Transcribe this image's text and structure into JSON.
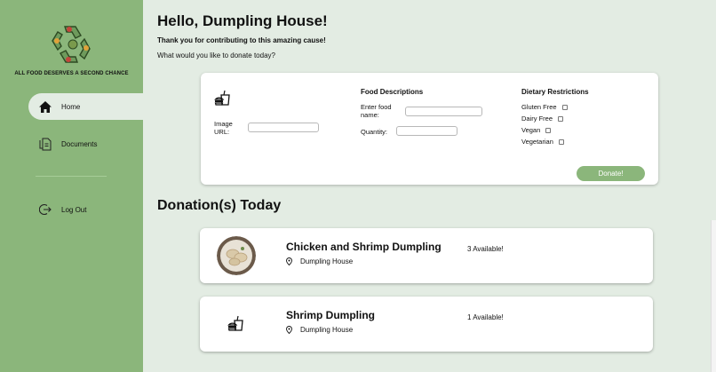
{
  "sidebar": {
    "tagline": "ALL FOOD DESERVES A SECOND CHANCE",
    "logo_icon": "recycle-food-logo",
    "items": [
      {
        "label": "Home",
        "icon": "home-icon",
        "active": true
      },
      {
        "label": "Documents",
        "icon": "documents-icon",
        "active": false
      },
      {
        "label": "Log Out",
        "icon": "logout-icon",
        "active": false
      }
    ]
  },
  "header": {
    "greeting": "Hello, Dumpling House!",
    "thanks": "Thank you for contributing to this amazing cause!",
    "question": "What would you like to donate today?"
  },
  "form": {
    "image_url_label": "Image URL:",
    "image_url_value": "",
    "descriptions_heading": "Food Descriptions",
    "food_name_label": "Enter food name:",
    "food_name_value": "",
    "quantity_label": "Quantity:",
    "quantity_value": "",
    "dietary_heading": "Dietary Restrictions",
    "dietary_options": [
      {
        "label": "Gluten Free",
        "checked": false
      },
      {
        "label": "Dairy Free",
        "checked": false
      },
      {
        "label": "Vegan",
        "checked": false
      },
      {
        "label": "Vegetarian",
        "checked": false
      }
    ],
    "donate_label": "Donate!"
  },
  "donations": {
    "title": "Donation(s) Today",
    "items": [
      {
        "name": "Chicken and Shrimp Dumpling",
        "location": "Dumpling House",
        "availability": "3 Available!",
        "image": "dumpling-photo"
      },
      {
        "name": "Shrimp Dumpling",
        "location": "Dumpling House",
        "availability": "1 Available!",
        "image": "food-placeholder-icon"
      }
    ]
  },
  "colors": {
    "sidebar": "#8bb67b",
    "background": "#e3ece3",
    "button": "#8bb67b"
  }
}
